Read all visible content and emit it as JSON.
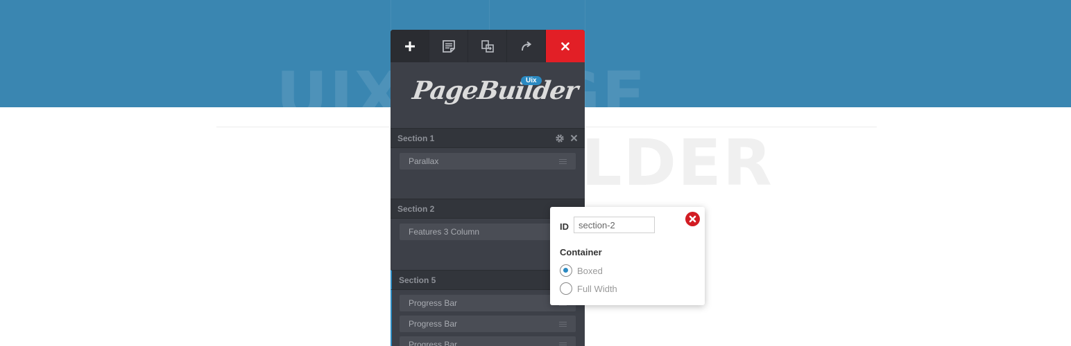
{
  "background": {
    "hero_word_1_left": "UIX",
    "hero_word_1_right": "GE",
    "hero_word_2": "LDER"
  },
  "toolbar": {
    "buttons": [
      {
        "icon": "plus-icon"
      },
      {
        "icon": "template-icon"
      },
      {
        "icon": "duplicate-icon"
      },
      {
        "icon": "redo-icon"
      },
      {
        "icon": "close-icon"
      }
    ]
  },
  "logo": {
    "text": "PageBuilder",
    "badge": "Uix"
  },
  "sections": [
    {
      "title": "Section 1",
      "modules": [
        "Parallax"
      ]
    },
    {
      "title": "Section 2",
      "modules": [
        "Features 3 Column"
      ]
    },
    {
      "title": "Section 5",
      "modules": [
        "Progress Bar",
        "Progress Bar",
        "Progress Bar"
      ]
    }
  ],
  "popover": {
    "id_label": "ID",
    "id_value": "section-2",
    "container_label": "Container",
    "options": [
      {
        "label": "Boxed",
        "checked": true
      },
      {
        "label": "Full Width",
        "checked": false
      }
    ]
  },
  "colors": {
    "hero_blue": "#3a86b1",
    "panel_dark": "#3d4048",
    "close_red": "#e21f26",
    "accent_blue": "#2b8ac2"
  }
}
